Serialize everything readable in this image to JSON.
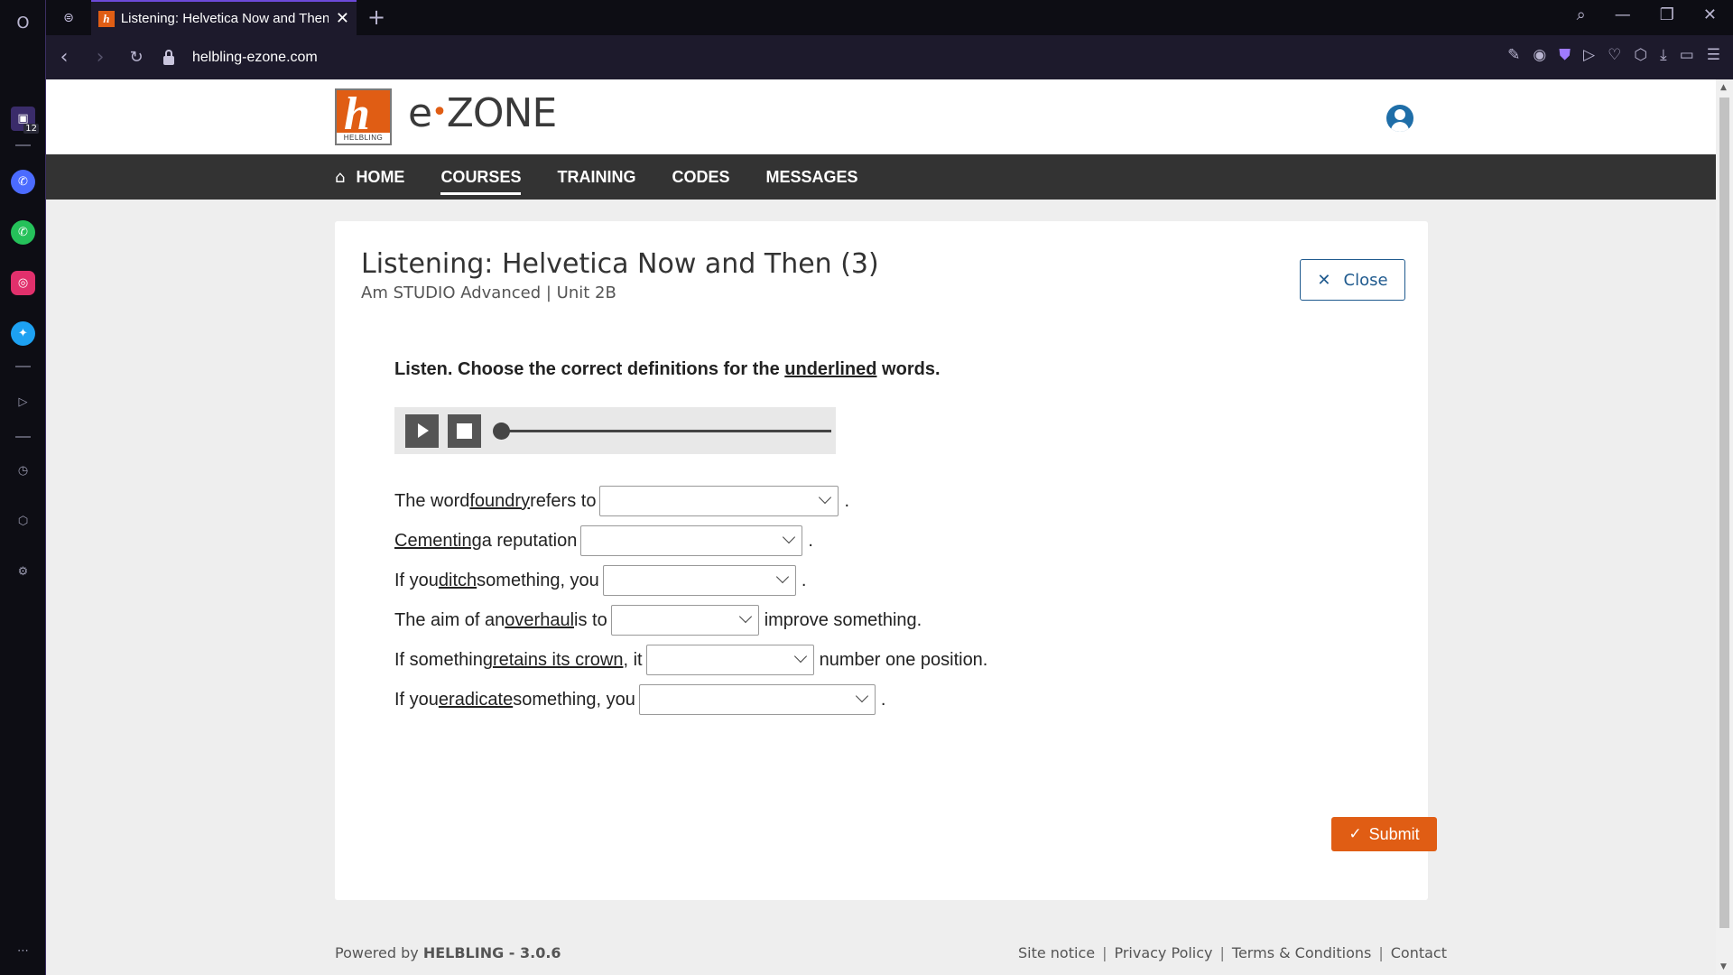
{
  "browser": {
    "tab_title": "Listening: Helvetica Now and Then (3)",
    "tab_close": "✕",
    "new_tab": "+",
    "url": "helbling-ezone.com",
    "badge_count": "12"
  },
  "site": {
    "logo_letter": "h",
    "logo_caption": "HELBLING",
    "brand_prefix": "e",
    "brand_dot": "•",
    "brand_suffix": "ZONE"
  },
  "nav": {
    "items": [
      {
        "label": "HOME"
      },
      {
        "label": "COURSES",
        "active": true
      },
      {
        "label": "TRAINING"
      },
      {
        "label": "CODES"
      },
      {
        "label": "MESSAGES"
      }
    ]
  },
  "exercise": {
    "title": "Listening: Helvetica Now and Then (3)",
    "subtitle": "Am STUDIO Advanced | Unit 2B",
    "close_label": "Close",
    "instruction_pre": "Listen. Choose the correct definitions for the ",
    "instruction_underlined": "underlined",
    "instruction_post": " words.",
    "audio": {
      "progress": 0
    },
    "rows": [
      {
        "pre": "The word ",
        "u": "foundry",
        "mid": " refers to",
        "post": ".",
        "selected": ""
      },
      {
        "pre": "",
        "u": "Cementing",
        "mid": " a reputation",
        "post": ".",
        "selected": ""
      },
      {
        "pre": "If you ",
        "u": "ditch",
        "mid": " something, you",
        "post": ".",
        "selected": ""
      },
      {
        "pre": "The aim of an ",
        "u": "overhaul",
        "mid": " is to",
        "post": " improve something.",
        "selected": ""
      },
      {
        "pre": "If something ",
        "u": "retains its crown",
        "mid": ", it",
        "post": " number one position.",
        "selected": ""
      },
      {
        "pre": "If you ",
        "u": "eradicate",
        "mid": " something, you",
        "post": ".",
        "selected": ""
      }
    ],
    "submit_label": "Submit"
  },
  "footer": {
    "powered_pre": "Powered by ",
    "powered_brand": "HELBLING - 3.0.6",
    "links": [
      "Site notice",
      "Privacy Policy",
      "Terms & Conditions",
      "Contact"
    ]
  },
  "colors": {
    "accent": "#e05d14",
    "nav_bg": "#333333",
    "link_blue": "#1f5a8e"
  }
}
